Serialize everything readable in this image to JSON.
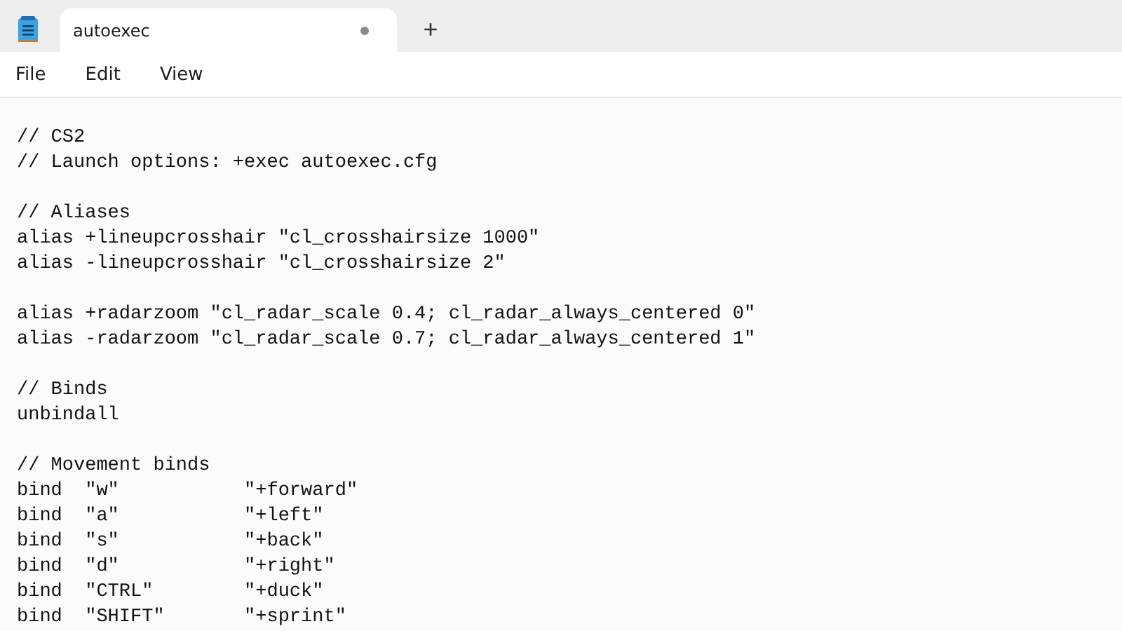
{
  "window": {
    "tabs": [
      {
        "title": "autoexec",
        "modified": true,
        "selected": true
      }
    ],
    "new_tab": "+"
  },
  "menu": [
    "File",
    "Edit",
    "View"
  ],
  "editor": {
    "blocks": [
      [
        "// CS2",
        "// Launch options: +exec autoexec.cfg"
      ],
      [
        "// Aliases",
        "alias +lineupcrosshair \"cl_crosshairsize 1000\"",
        "alias -lineupcrosshair \"cl_crosshairsize 2\""
      ],
      [
        "alias +radarzoom \"cl_radar_scale 0.4; cl_radar_always_centered 0\"",
        "alias -radarzoom \"cl_radar_scale 0.7; cl_radar_always_centered 1\""
      ],
      [
        "// Binds",
        "unbindall"
      ],
      [
        "// Movement binds",
        "bind  \"w\"           \"+forward\"",
        "bind  \"a\"           \"+left\"",
        "bind  \"s\"           \"+back\"",
        "bind  \"d\"           \"+right\"",
        "bind  \"CTRL\"        \"+duck\"",
        "bind  \"SHIFT\"       \"+sprint\""
      ]
    ]
  }
}
